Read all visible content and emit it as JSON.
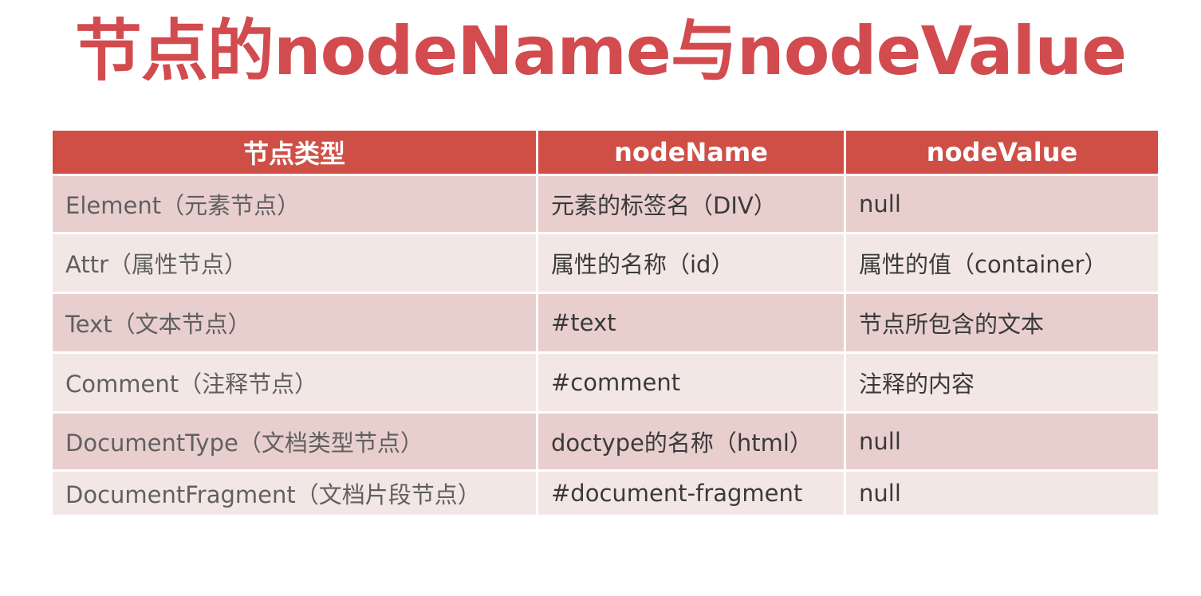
{
  "title": "节点的nodeName与nodeValue",
  "table": {
    "headers": [
      "节点类型",
      "nodeName",
      "nodeValue"
    ],
    "rows": [
      [
        "Element（元素节点）",
        "元素的标签名（DIV）",
        "null"
      ],
      [
        "Attr（属性节点）",
        "属性的名称（id）",
        "属性的值（container）"
      ],
      [
        "Text（文本节点）",
        "#text",
        "节点所包含的文本"
      ],
      [
        "Comment（注释节点）",
        "#comment",
        "注释的内容"
      ],
      [
        "DocumentType（文档类型节点）",
        "doctype的名称（html）",
        "null"
      ],
      [
        "DocumentFragment（文档片段节点）",
        "#document-fragment",
        "null"
      ]
    ]
  },
  "colors": {
    "title": "#d24b4f",
    "header_bg": "#cf4f46",
    "row_odd_bg": "#e8cfce",
    "row_even_bg": "#f3e7e6"
  }
}
